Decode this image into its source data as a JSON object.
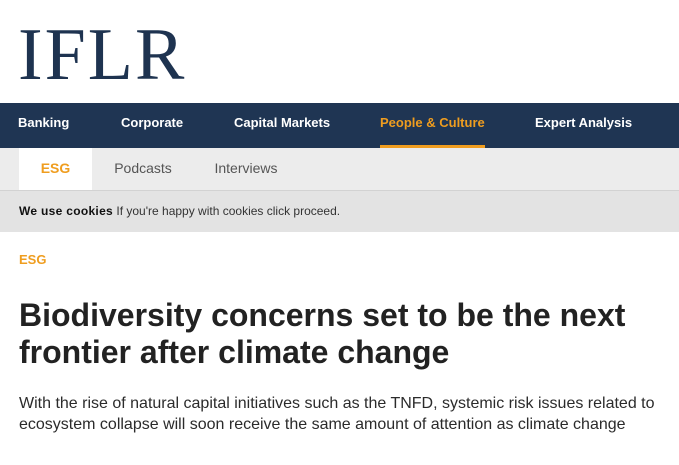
{
  "brand": {
    "logo_text": "IFLR"
  },
  "main_nav": [
    {
      "label": "Banking",
      "active": false
    },
    {
      "label": "Corporate",
      "active": false
    },
    {
      "label": "Capital Markets",
      "active": false
    },
    {
      "label": "People & Culture",
      "active": true
    },
    {
      "label": "Expert Analysis",
      "active": false
    }
  ],
  "sub_nav": [
    {
      "label": "ESG",
      "active": true
    },
    {
      "label": "Podcasts",
      "active": false
    },
    {
      "label": "Interviews",
      "active": false
    }
  ],
  "cookie_bar": {
    "title": "We use cookies",
    "message": "If you're happy with cookies click proceed."
  },
  "article": {
    "kicker": "ESG",
    "headline": "Biodiversity concerns set to be the next frontier after climate change",
    "standfirst": "With the rise of natural capital initiatives such as the TNFD, systemic risk issues related to ecosystem collapse will soon receive the same amount of attention as climate change"
  },
  "colors": {
    "nav_background": "#1f3553",
    "accent": "#ef9d1f",
    "logo": "#1e3350"
  }
}
